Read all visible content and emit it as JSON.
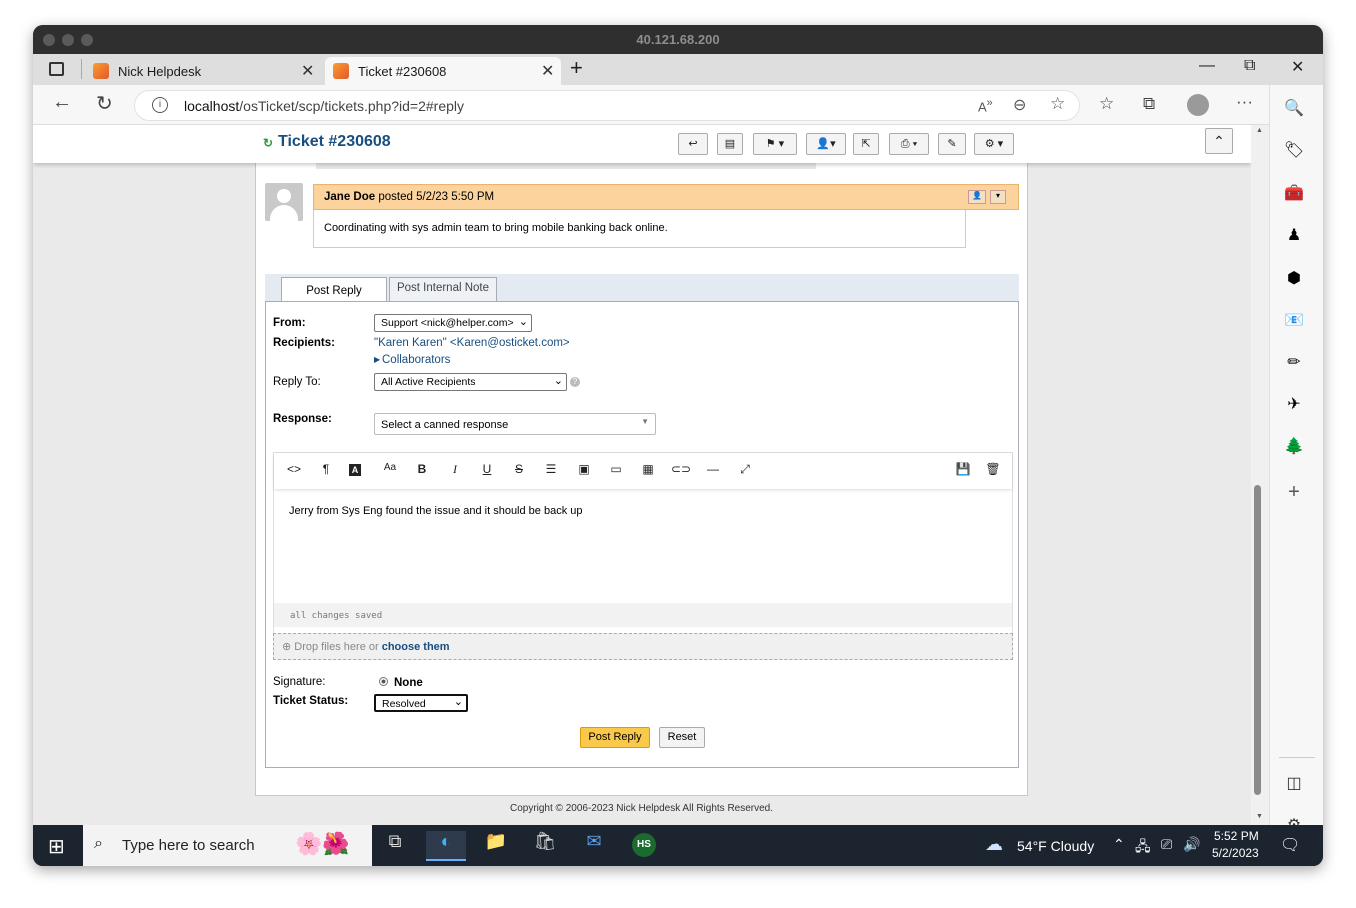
{
  "window": {
    "title": "40.121.68.200"
  },
  "tabs": [
    {
      "label": "Nick Helpdesk",
      "close": "✕"
    },
    {
      "label": "Ticket #230608",
      "close": "✕"
    }
  ],
  "new_tab": "+",
  "window_controls": {
    "minimize": "—",
    "restore": "⧉",
    "close": "✕"
  },
  "address": {
    "host": "localhost",
    "path": "/osTicket/scp/tickets.php?id=2#reply"
  },
  "ticket": {
    "title": "Ticket #230608",
    "thread": {
      "author": "Jane Doe",
      "posted_label": "posted",
      "date": "5/2/23 5:50 PM",
      "body": "Coordinating with sys admin team to bring mobile banking back online."
    },
    "reply_tabs": [
      "Post Reply",
      "Post Internal Note"
    ],
    "from_label": "From:",
    "from_value": "Support <nick@helper.com>",
    "recipients_label": "Recipients:",
    "recipient": "\"Karen Karen\" <Karen@osticket.com>",
    "collaborators": "Collaborators",
    "reply_to_label": "Reply To:",
    "reply_to_value": "All Active Recipients",
    "response_label": "Response:",
    "canned_placeholder": "Select a canned response",
    "editor_text": "Jerry from Sys Eng found the issue and it should be back up",
    "saved_status": "all changes saved",
    "drop_text": "Drop files here or",
    "choose_link": "choose them",
    "signature_label": "Signature:",
    "signature_value": "None",
    "status_label": "Ticket Status:",
    "status_value": "Resolved",
    "post_button": "Post Reply",
    "reset_button": "Reset"
  },
  "copyright": "Copyright © 2006-2023 Nick Helpdesk All Rights Reserved.",
  "taskbar": {
    "search_placeholder": "Type here to search",
    "weather": "54°F  Cloudy",
    "time": "5:52 PM",
    "date": "5/2/2023"
  },
  "colors": {
    "accent": "#184e81",
    "thread_header": "#fcd39c",
    "post_button": "#fbc94a",
    "taskbar": "#1c2430"
  }
}
